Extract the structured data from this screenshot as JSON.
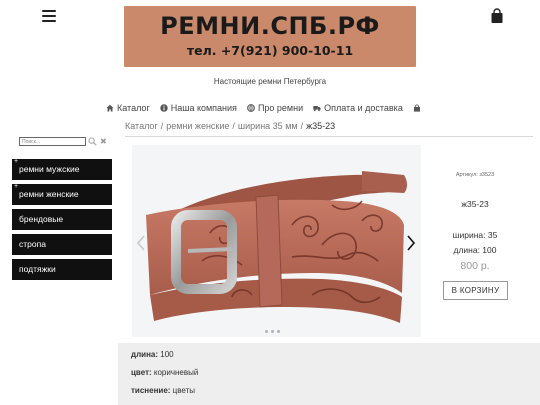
{
  "header": {
    "logo_title": "РЕМНИ.СПБ.РФ",
    "logo_phone": "тел. +7(921) 900-10-11",
    "tagline": "Настоящие ремни Петербурга",
    "logo_color": "#c9896a"
  },
  "nav": {
    "items": [
      {
        "label": "Каталог",
        "icon": "home-icon"
      },
      {
        "label": "Наша компания",
        "icon": "info-icon"
      },
      {
        "label": "Про ремни",
        "icon": "globe-icon"
      },
      {
        "label": "Оплата и доставка",
        "icon": "truck-icon"
      }
    ],
    "cart_icon": "shopping-bag-icon"
  },
  "breadcrumb": {
    "items": [
      "Каталог",
      "ремни женские",
      "ширина 35 мм"
    ],
    "current": "ж35-23",
    "separator": "/"
  },
  "search": {
    "placeholder": "Поиск..."
  },
  "sidebar": {
    "categories": [
      {
        "label": "ремни мужские",
        "expandable": true
      },
      {
        "label": "ремни женские",
        "expandable": true
      },
      {
        "label": "брендовые",
        "expandable": false
      },
      {
        "label": "стропа",
        "expandable": false
      },
      {
        "label": "подтяжки",
        "expandable": false
      }
    ],
    "plus_symbol": "+"
  },
  "product": {
    "sku": "Артикул: з3523",
    "name": "ж35-23",
    "width": "ширина: 35",
    "length": "длина: 100",
    "price": "800 р.",
    "cart_button": "В КОРЗИНУ",
    "belt_color": "#b56a56",
    "slides_total": 3
  },
  "attributes": {
    "length_label": "длина:",
    "length_value": "100",
    "color_label": "цвет:",
    "color_value": "коричневый",
    "emboss_label": "тиснение:",
    "emboss_value": "цветы"
  }
}
